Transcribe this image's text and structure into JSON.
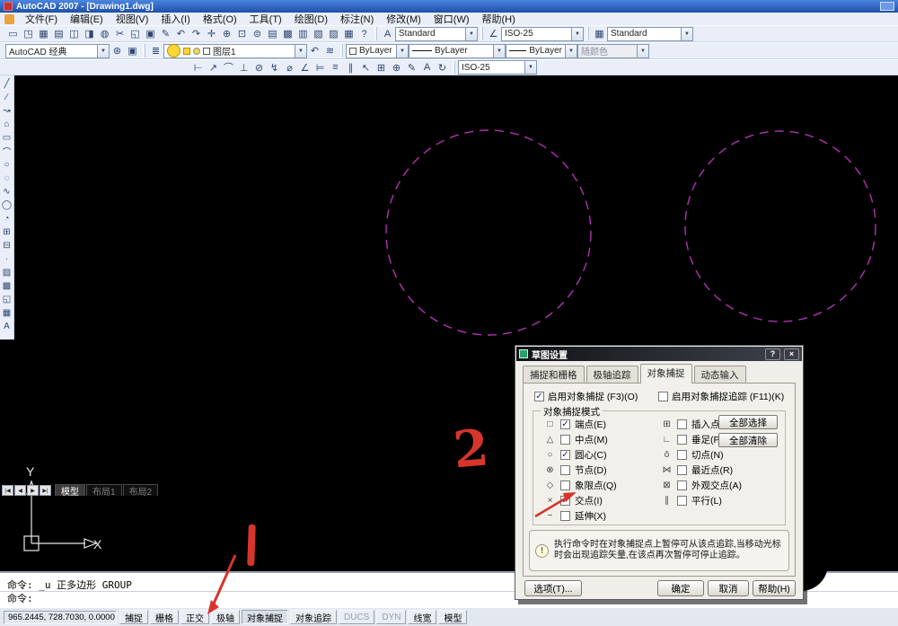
{
  "window": {
    "title": "AutoCAD 2007 - [Drawing1.dwg]"
  },
  "menu_bar": {
    "items": [
      "文件(F)",
      "编辑(E)",
      "视图(V)",
      "插入(I)",
      "格式(O)",
      "工具(T)",
      "绘图(D)",
      "标注(N)",
      "修改(M)",
      "窗口(W)",
      "帮助(H)"
    ]
  },
  "ui": {
    "combo_arrow": "▼",
    "bulb_glyph": "!"
  },
  "toolbar_standard": {
    "icons": [
      {
        "name": "new-icon",
        "glyph": "▭"
      },
      {
        "name": "open-icon",
        "glyph": "◳"
      },
      {
        "name": "save-icon",
        "glyph": "▦"
      },
      {
        "name": "plot-icon",
        "glyph": "▤"
      },
      {
        "name": "plot-preview-icon",
        "glyph": "◫"
      },
      {
        "name": "publish-icon",
        "glyph": "◨"
      },
      {
        "name": "3d-dwf-icon",
        "glyph": "◍"
      },
      {
        "name": "cut-icon",
        "glyph": "✂"
      },
      {
        "name": "copy-icon",
        "glyph": "◱"
      },
      {
        "name": "paste-icon",
        "glyph": "▣"
      },
      {
        "name": "match-properties-icon",
        "glyph": "✎"
      },
      {
        "name": "undo-icon",
        "glyph": "↶"
      },
      {
        "name": "redo-icon",
        "glyph": "↷"
      },
      {
        "name": "pan-icon",
        "glyph": "✛"
      },
      {
        "name": "zoom-realtime-icon",
        "glyph": "⊕"
      },
      {
        "name": "zoom-window-icon",
        "glyph": "⊡"
      },
      {
        "name": "zoom-previous-icon",
        "glyph": "⊜"
      },
      {
        "name": "properties-icon",
        "glyph": "▤"
      },
      {
        "name": "designcenter-icon",
        "glyph": "▩"
      },
      {
        "name": "tool-palettes-icon",
        "glyph": "▥"
      },
      {
        "name": "sheet-set-icon",
        "glyph": "▧"
      },
      {
        "name": "markup-icon",
        "glyph": "▨"
      },
      {
        "name": "quick-calc-icon",
        "glyph": "▦"
      },
      {
        "name": "help-icon",
        "glyph": "?"
      }
    ]
  },
  "toolbar_styles": {
    "text_icon": "A",
    "dim_icon": "∠",
    "table_icon": "▦",
    "text_style_label": "Standard",
    "dim_style_label": "ISO-25",
    "table_style_label": "Standard"
  },
  "toolbar_workspace": {
    "workspace": "AutoCAD 经典",
    "icons": [
      {
        "name": "workspace-settings-icon",
        "glyph": "⊛"
      },
      {
        "name": "my-workspace-icon",
        "glyph": "▣"
      }
    ]
  },
  "toolbar_layers": {
    "manager_icon": "≣",
    "layer_name": "图层1",
    "icons": [
      {
        "name": "make-object-layer-current-icon",
        "glyph": "↶"
      },
      {
        "name": "layer-previous-icon",
        "glyph": "≋"
      }
    ]
  },
  "toolbar_properties": {
    "color": "ByLayer",
    "linetype": "ByLayer",
    "lineweight": "ByLayer",
    "plot_style": "随颜色"
  },
  "toolbar_dimension": {
    "dim_style": "ISO-25",
    "icons": [
      {
        "name": "linear-dimension-icon",
        "glyph": "⊢"
      },
      {
        "name": "aligned-dimension-icon",
        "glyph": "↗"
      },
      {
        "name": "arc-length-icon",
        "glyph": "⌒"
      },
      {
        "name": "ordinate-icon",
        "glyph": "⊥"
      },
      {
        "name": "radius-icon",
        "glyph": "⊘"
      },
      {
        "name": "jogged-icon",
        "glyph": "↯"
      },
      {
        "name": "diameter-icon",
        "glyph": "⌀"
      },
      {
        "name": "angular-icon",
        "glyph": "∠"
      },
      {
        "name": "quick-dimension-icon",
        "glyph": "⊨"
      },
      {
        "name": "baseline-icon",
        "glyph": "≡"
      },
      {
        "name": "continue-icon",
        "glyph": "∥"
      },
      {
        "name": "quick-leader-icon",
        "glyph": "↖"
      },
      {
        "name": "tolerance-icon",
        "glyph": "⊞"
      },
      {
        "name": "center-mark-icon",
        "glyph": "⊕"
      },
      {
        "name": "dimension-edit-icon",
        "glyph": "✎"
      },
      {
        "name": "dimension-text-edit-icon",
        "glyph": "A"
      },
      {
        "name": "dimension-update-icon",
        "glyph": "↻"
      }
    ]
  },
  "toolbar_draw": {
    "icons": [
      {
        "name": "line-icon",
        "glyph": "╱"
      },
      {
        "name": "construction-line-icon",
        "glyph": "∕"
      },
      {
        "name": "polyline-icon",
        "glyph": "↝"
      },
      {
        "name": "polygon-icon",
        "glyph": "⌂"
      },
      {
        "name": "rectangle-icon",
        "glyph": "▭"
      },
      {
        "name": "arc-icon",
        "glyph": "⌒"
      },
      {
        "name": "circle-icon",
        "glyph": "○"
      },
      {
        "name": "revision-cloud-icon",
        "glyph": "◌"
      },
      {
        "name": "spline-icon",
        "glyph": "∿"
      },
      {
        "name": "ellipse-icon",
        "glyph": "◯"
      },
      {
        "name": "ellipse-arc-icon",
        "glyph": "◔"
      },
      {
        "name": "insert-block-icon",
        "glyph": "⊞"
      },
      {
        "name": "make-block-icon",
        "glyph": "⊟"
      },
      {
        "name": "point-icon",
        "glyph": "·"
      },
      {
        "name": "hatch-icon",
        "glyph": "▨"
      },
      {
        "name": "gradient-icon",
        "glyph": "▩"
      },
      {
        "name": "region-icon",
        "glyph": "◱"
      },
      {
        "name": "table-icon",
        "glyph": "▦"
      },
      {
        "name": "mtext-icon",
        "glyph": "A"
      }
    ]
  },
  "canvas": {
    "circle_color": "#b232b2",
    "ucs": {
      "x_label": "X",
      "y_label": "Y"
    }
  },
  "annotations": {
    "color": "#d6352b",
    "step_1": "1",
    "step_2": "2"
  },
  "layout_tabs": {
    "nav": [
      {
        "name": "first-tab-button",
        "glyph": "|◀"
      },
      {
        "name": "prev-tab-button",
        "glyph": "◀"
      },
      {
        "name": "next-tab-button",
        "glyph": "▶"
      },
      {
        "name": "last-tab-button",
        "glyph": "▶|"
      }
    ],
    "tabs": [
      {
        "label": "模型",
        "state": "active"
      },
      {
        "label": "布局1",
        "state": ""
      },
      {
        "label": "布局2",
        "state": ""
      }
    ]
  },
  "command_line": {
    "line1": "命令: _u 正多边形 GROUP",
    "line2": "命令:"
  },
  "status_bar": {
    "coordinates": "965.2445, 728.7030, 0.0000",
    "toggles": [
      {
        "label": "捕捉",
        "state": ""
      },
      {
        "label": "栅格",
        "state": ""
      },
      {
        "label": "正交",
        "state": ""
      },
      {
        "label": "极轴",
        "state": ""
      },
      {
        "label": "对象捕捉",
        "state": "pressed"
      },
      {
        "label": "对象追踪",
        "state": ""
      },
      {
        "label": "DUCS",
        "state": "dim"
      },
      {
        "label": "DYN",
        "state": "dim"
      },
      {
        "label": "线宽",
        "state": ""
      },
      {
        "label": "模型",
        "state": ""
      }
    ]
  },
  "dialog": {
    "title": "草图设置",
    "help_glyph": "?",
    "close_glyph": "×",
    "tabs": [
      {
        "label": "捕捉和栅格",
        "state": ""
      },
      {
        "label": "极轴追踪",
        "state": ""
      },
      {
        "label": "对象捕捉",
        "state": "active"
      },
      {
        "label": "动态输入",
        "state": ""
      }
    ],
    "enable_osnap_label": "启用对象捕捉 (F3)(O)",
    "enable_osnap_checked": true,
    "enable_otrack_label": "启用对象捕捉追踪 (F11)(K)",
    "enable_otrack_checked": false,
    "group_label": "对象捕捉模式",
    "snap_left": [
      {
        "marker": "□",
        "label": "端点(E)",
        "checked": true
      },
      {
        "marker": "△",
        "label": "中点(M)",
        "checked": false
      },
      {
        "marker": "○",
        "label": "圆心(C)",
        "checked": true
      },
      {
        "marker": "⊗",
        "label": "节点(D)",
        "checked": false
      },
      {
        "marker": "◇",
        "label": "象限点(Q)",
        "checked": false
      },
      {
        "marker": "×",
        "label": "交点(I)",
        "checked": true
      },
      {
        "marker": "−",
        "label": "延伸(X)",
        "checked": false
      }
    ],
    "snap_right": [
      {
        "marker": "⊞",
        "label": "插入点(S)",
        "checked": false
      },
      {
        "marker": "∟",
        "label": "垂足(P)",
        "checked": false
      },
      {
        "marker": "ō",
        "label": "切点(N)",
        "checked": false
      },
      {
        "marker": "⋈",
        "label": "最近点(R)",
        "checked": false
      },
      {
        "marker": "⊠",
        "label": "外观交点(A)",
        "checked": false
      },
      {
        "marker": "∥",
        "label": "平行(L)",
        "checked": false
      }
    ],
    "select_all_label": "全部选择",
    "clear_all_label": "全部清除",
    "tip_text": "执行命令时在对象捕捉点上暂停可从该点追踪,当移动光标时会出现追踪矢量,在该点再次暂停可停止追踪。",
    "options_label": "选项(T)...",
    "ok_label": "确定",
    "cancel_label": "取消",
    "help_label": "帮助(H)"
  }
}
